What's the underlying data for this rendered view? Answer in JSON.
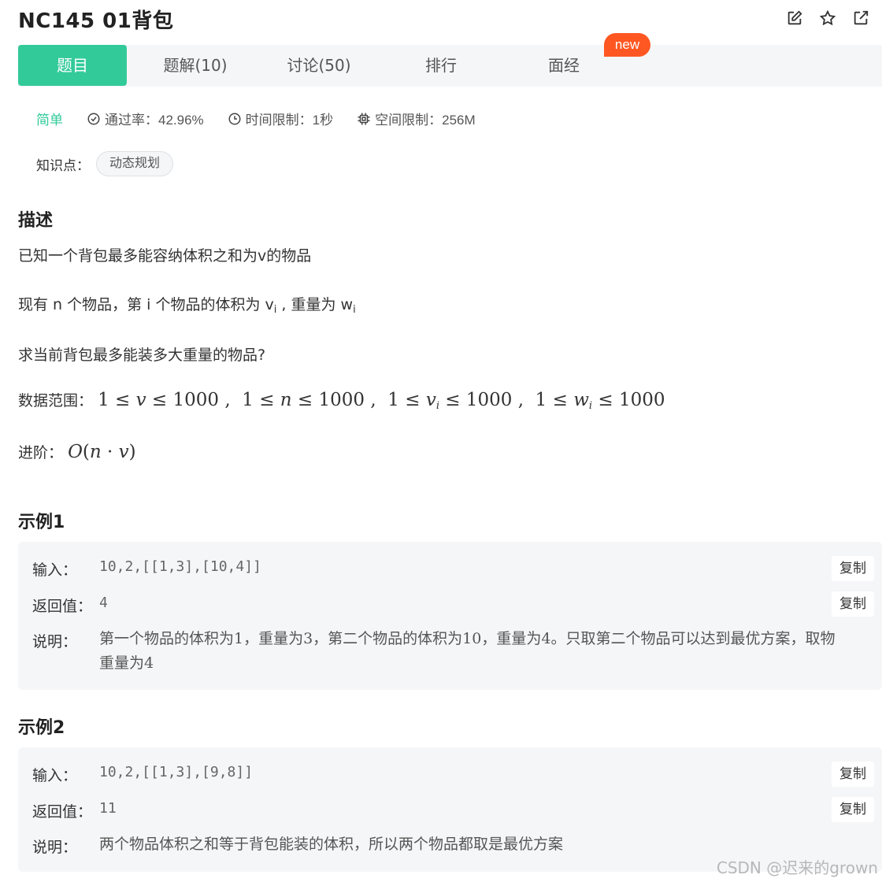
{
  "problem": {
    "title": "NC145  01背包"
  },
  "tabs": [
    {
      "label": "题目"
    },
    {
      "label": "题解(10)"
    },
    {
      "label": "讨论(50)"
    },
    {
      "label": "排行"
    },
    {
      "label": "面经"
    }
  ],
  "badge": {
    "label": "new"
  },
  "meta": {
    "difficulty": "简单",
    "pass_rate": "通过率：42.96%",
    "time_limit": "时间限制：1秒",
    "memory_limit": "空间限制：256M"
  },
  "knowledge": {
    "label": "知识点：",
    "tag": "动态规划"
  },
  "description": {
    "heading": "描述",
    "line1": "已知一个背包最多能容纳体积之和为v的物品",
    "line2_a": "现有 n 个物品，第 i 个物品的体积为 v",
    "line2_b": "i",
    "line2_c": " , 重量为 w",
    "line2_d": "i",
    "line3": "求当前背包最多能装多大重量的物品?",
    "range_label": "数据范围：",
    "advanced_label": "进阶："
  },
  "examples": [
    {
      "heading": "示例1",
      "input_label": "输入：",
      "input": "10,2,[[1,3],[10,4]]",
      "output_label": "返回值：",
      "output": "4",
      "explain_label": "说明：",
      "explain": "第一个物品的体积为1，重量为3，第二个物品的体积为10，重量为4。只取第二个物品可以达到最优方案，取物重量为4",
      "copy": "复制"
    },
    {
      "heading": "示例2",
      "input_label": "输入：",
      "input": "10,2,[[1,3],[9,8]]",
      "output_label": "返回值：",
      "output": "11",
      "explain_label": "说明：",
      "explain": "两个物品体积之和等于背包能装的体积，所以两个物品都取是最优方案",
      "copy": "复制"
    }
  ],
  "watermark": "CSDN @迟来的grown",
  "icons": [
    "edit-icon",
    "star-icon",
    "share-icon",
    "check-circle-icon",
    "clock-icon",
    "chip-icon"
  ]
}
